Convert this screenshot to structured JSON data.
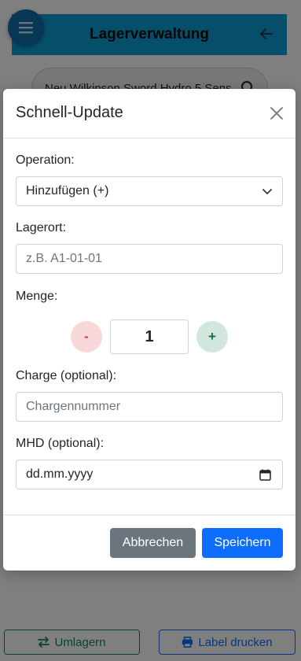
{
  "app": {
    "title": "Lagerverwaltung",
    "search_pill_text": "Neu Wilkinson Sword Hydro 5 Sens"
  },
  "bottom_bar": {
    "umlagern_label": "Umlagern",
    "label_drucken_label": "Label drucken"
  },
  "modal": {
    "title": "Schnell-Update",
    "operation": {
      "label": "Operation:",
      "selected": "Hinzufügen (+)"
    },
    "lagerort": {
      "label": "Lagerort:",
      "placeholder": "z.B. A1-01-01"
    },
    "menge": {
      "label": "Menge:",
      "minus": "-",
      "value": "1",
      "plus": "+"
    },
    "charge": {
      "label": "Charge (optional):",
      "placeholder": "Chargennummer"
    },
    "mhd": {
      "label": "MHD (optional):",
      "value": "dd.mm.yyyy"
    },
    "cancel_label": "Abbrechen",
    "save_label": "Speichern"
  },
  "colors": {
    "header": "#0d9fd4",
    "primary": "#0d6efd",
    "secondary": "#6c757d",
    "success": "#198754",
    "danger": "#dc3545"
  }
}
